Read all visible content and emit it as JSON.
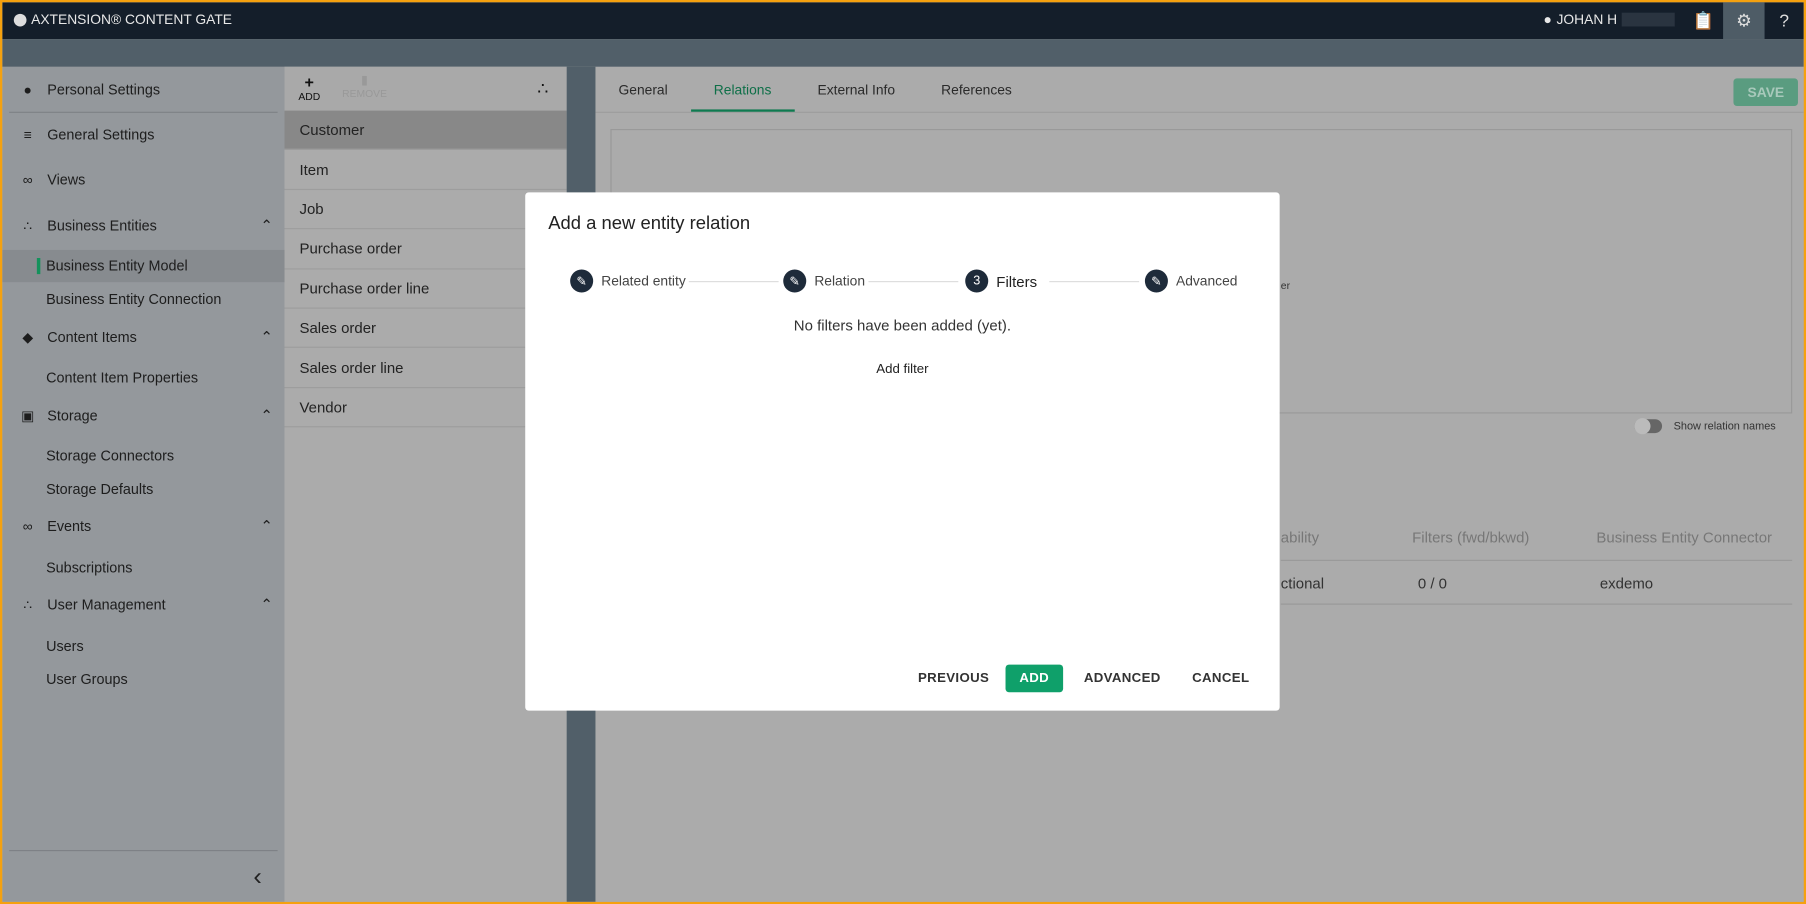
{
  "app": {
    "title": "AXTENSION® CONTENT GATE",
    "user": "JOHAN H",
    "icons": [
      "clipboard-icon",
      "gear-icon",
      "help-icon"
    ],
    "help_label": "?"
  },
  "sidebar": {
    "items": [
      {
        "label": "Personal Settings",
        "icon": "person-icon"
      },
      {
        "label": "General Settings",
        "icon": "sliders-icon"
      },
      {
        "label": "Views",
        "icon": "glasses-icon"
      },
      {
        "label": "Business Entities",
        "icon": "hierarchy-icon",
        "expanded": true
      },
      {
        "label": "Business Entity Model",
        "active": true
      },
      {
        "label": "Business Entity Connection"
      },
      {
        "label": "Content Items",
        "icon": "tag-icon",
        "expanded": true
      },
      {
        "label": "Content Item Properties"
      },
      {
        "label": "Storage",
        "icon": "archive-icon",
        "expanded": true
      },
      {
        "label": "Storage Connectors"
      },
      {
        "label": "Storage Defaults"
      },
      {
        "label": "Events",
        "icon": "webhook-icon",
        "expanded": true
      },
      {
        "label": "Subscriptions"
      },
      {
        "label": "User Management",
        "icon": "users-icon",
        "expanded": true
      },
      {
        "label": "Users"
      },
      {
        "label": "User Groups"
      }
    ]
  },
  "entity_list": {
    "add_label": "ADD",
    "remove_label": "REMOVE",
    "items": [
      "Customer",
      "Item",
      "Job",
      "Purchase order",
      "Purchase order line",
      "Sales order",
      "Sales order line",
      "Vendor"
    ],
    "selected": "Customer"
  },
  "main": {
    "tabs": [
      "General",
      "Relations",
      "External Info",
      "References"
    ],
    "active_tab": "Relations",
    "save_label": "SAVE",
    "partial_text": "er",
    "toggle_label": "Show relation names",
    "toggle_on": false,
    "table": {
      "headers": [
        "ability",
        "Filters (fwd/bkwd)",
        "Business Entity Connector"
      ],
      "row": [
        "ctional",
        "0 / 0",
        "exdemo"
      ]
    }
  },
  "dialog": {
    "title": "Add a new entity relation",
    "steps": [
      {
        "label": "Related entity",
        "icon": "pencil-icon"
      },
      {
        "label": "Relation",
        "icon": "pencil-icon"
      },
      {
        "label": "Filters",
        "number": "3",
        "active": true
      },
      {
        "label": "Advanced",
        "icon": "pencil-icon"
      }
    ],
    "empty_text": "No filters have been added (yet).",
    "add_filter_label": "Add filter",
    "buttons": {
      "previous": "PREVIOUS",
      "add": "ADD",
      "advanced": "ADVANCED",
      "cancel": "CANCEL"
    }
  },
  "colors": {
    "accent": "#0fa06a",
    "header": "#141e2a",
    "frame": "#f5a10f"
  }
}
